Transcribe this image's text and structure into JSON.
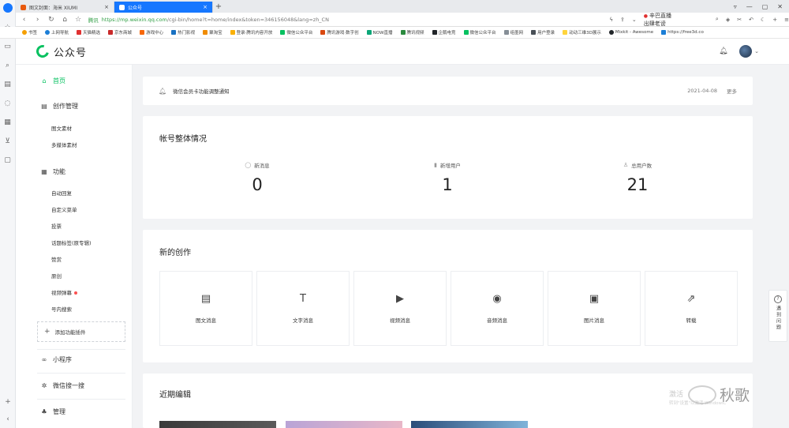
{
  "browser": {
    "tabs": [
      {
        "title": "图文封面：海米 XIUMI",
        "active": false
      },
      {
        "title": "公众号",
        "active": true
      }
    ],
    "new_tab": "+",
    "window_controls": [
      "▿",
      "—",
      "▢",
      "✕"
    ],
    "address": {
      "secure_label": "腾讯",
      "domain": "https://mp.weixin.qq.com",
      "path": "/cgi-bin/home?t=home/index&token=346156048&lang=zh_CN"
    },
    "hot_search": "辛巴直播出肆老谤",
    "bookmarks": [
      "书签",
      "上网导航",
      "天猫精选",
      "京东商城",
      "游戏中心",
      "热门影视",
      "聚淘宝",
      "登录·腾讯内容开放",
      "微信公众平台",
      "腾讯游戏·数字创",
      "NOW直播",
      "腾讯视频",
      "企鹅电竞",
      "微信公众平台",
      "组墨网",
      "用户登录",
      "动动三维3D展示",
      "Mixkit - Awesome",
      "https://free3d.co"
    ]
  },
  "header": {
    "brand": "公众号"
  },
  "menu": {
    "home": "首页",
    "creation": "创作管理",
    "creation_items": [
      "图文素材",
      "多媒体素材"
    ],
    "features": "功能",
    "feature_items": [
      "自动回复",
      "自定义菜单",
      "投票",
      "话题标签(原专辑)",
      "赞赏",
      "原创",
      "视频弹幕",
      "号内搜索"
    ],
    "add_plugin": "添加功能插件",
    "mini_program": "小程序",
    "wechat_search": "微信搜一搜",
    "manage": "管理"
  },
  "notice": {
    "text": "微信会员卡功能调整通知",
    "date": "2021-04-08",
    "more": "更多"
  },
  "overview": {
    "title": "帐号整体情况",
    "stats": [
      {
        "label": "新消息",
        "value": "0",
        "icon": "message-icon"
      },
      {
        "label": "新增用户",
        "value": "1",
        "icon": "bar-chart-icon"
      },
      {
        "label": "总用户数",
        "value": "21",
        "icon": "user-icon"
      }
    ]
  },
  "create": {
    "title": "新的创作",
    "tiles": [
      {
        "label": "图文消息",
        "icon": "article-icon",
        "glyph": "▤"
      },
      {
        "label": "文字消息",
        "icon": "text-icon",
        "glyph": "T"
      },
      {
        "label": "视频消息",
        "icon": "video-icon",
        "glyph": "▶"
      },
      {
        "label": "音频消息",
        "icon": "audio-icon",
        "glyph": "◉"
      },
      {
        "label": "图片消息",
        "icon": "image-icon",
        "glyph": "▣"
      },
      {
        "label": "转载",
        "icon": "repost-icon",
        "glyph": "⇗"
      }
    ]
  },
  "recent": {
    "title": "近期编辑"
  },
  "help": {
    "text": "遇到问题"
  },
  "watermarks": {
    "activate": "激活",
    "activate_sub": "转到\"设置\"以激活 Windows。",
    "brand": "秋歌"
  },
  "colors": {
    "accent": "#07c160",
    "browser_tab_active": "#1677ff",
    "page_bg": "#f2f3f5",
    "badge_red": "#fa5151"
  }
}
